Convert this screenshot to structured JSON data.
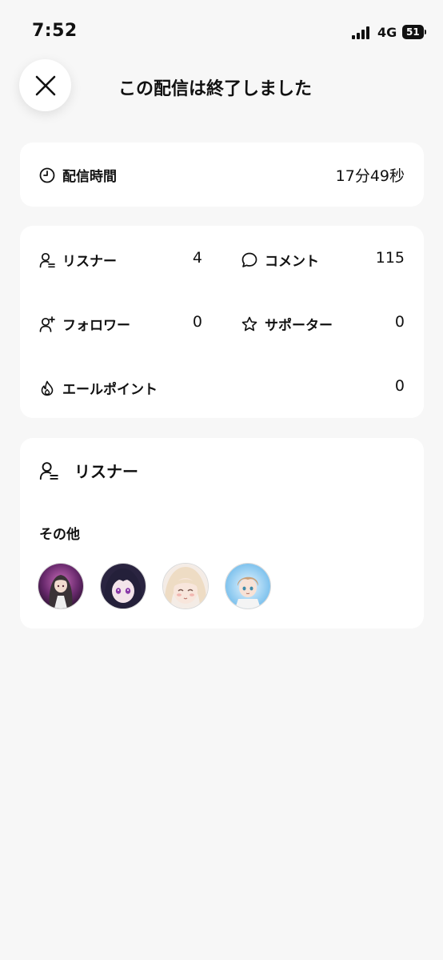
{
  "status_bar": {
    "time": "7:52",
    "network": "4G",
    "battery": "51"
  },
  "header": {
    "title": "この配信は終了しました",
    "close_icon": "close-icon"
  },
  "duration": {
    "icon": "clock-icon",
    "label": "配信時間",
    "value": "17分49秒"
  },
  "stats": {
    "listeners": {
      "icon": "person-icon",
      "label": "リスナー",
      "value": "4"
    },
    "comments": {
      "icon": "speech-bubble-icon",
      "label": "コメント",
      "value": "115"
    },
    "followers": {
      "icon": "person-add-icon",
      "label": "フォロワー",
      "value": "0"
    },
    "supporters": {
      "icon": "star-icon",
      "label": "サポーター",
      "value": "0"
    },
    "yell_points": {
      "icon": "flame-icon",
      "label": "エールポイント",
      "value": "0"
    }
  },
  "listener_section": {
    "icon": "person-icon",
    "heading": "リスナー",
    "group_label": "その他",
    "avatars": [
      "listener-avatar-1",
      "listener-avatar-2",
      "listener-avatar-3",
      "listener-avatar-4"
    ]
  },
  "colors": {
    "background": "#f7f7f7",
    "card": "#ffffff",
    "text": "#111111"
  }
}
